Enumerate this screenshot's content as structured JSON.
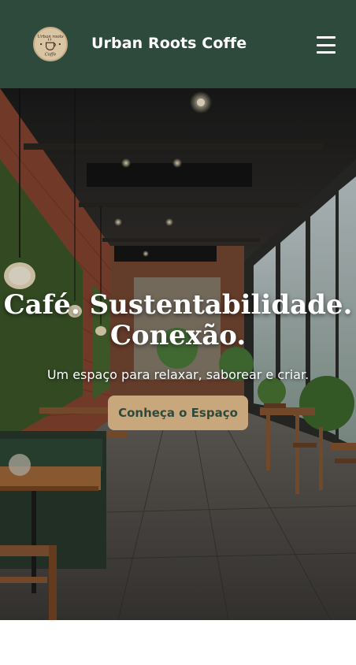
{
  "header": {
    "brand": "Urban Roots Coffe",
    "logo_text_top": "Urban roots",
    "logo_text_bottom": "Coffe",
    "menu_icon": "hamburger-menu-icon"
  },
  "hero": {
    "title_line1": "Café. Sustentabilidade.",
    "title_line2": "Conexão.",
    "subtitle": "Um espaço para relaxar, saborear e criar.",
    "cta_label": "Conheça o Espaço"
  },
  "colors": {
    "header_bg": "#2e4a3c",
    "accent": "#c8a77c",
    "text_light": "#ffffff"
  }
}
